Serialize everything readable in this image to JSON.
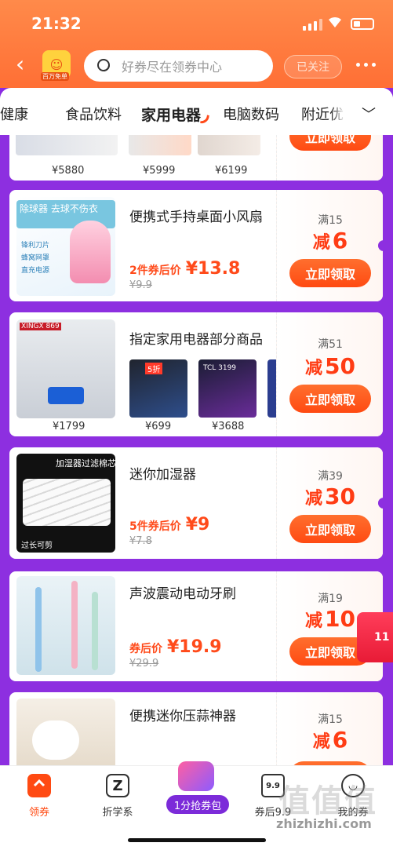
{
  "status": {
    "time": "21:32"
  },
  "header": {
    "shop_badge": "百万免单",
    "search_placeholder": "好券尽在领券中心",
    "follow_label": "已关注"
  },
  "tabs": [
    {
      "label": "康健康"
    },
    {
      "label": "食品饮料"
    },
    {
      "label": "家用电器",
      "active": true
    },
    {
      "label": "电脑数码"
    },
    {
      "label": "附近优"
    }
  ],
  "cards": [
    {
      "thumb_prices": [
        "¥5880",
        "¥5999",
        "¥6199"
      ],
      "claim_label": "立即领取"
    },
    {
      "title": "便携式手持桌面小风扇",
      "image_text": "除球器 去球不伤衣",
      "image_tags": [
        "锋利刀片",
        "蜂窝网罩",
        "直充电源"
      ],
      "price_tag": "2件券后价",
      "price": "¥13.8",
      "orig_price": "¥9.9",
      "threshold": "满15",
      "discount_word": "减",
      "discount_value": "6",
      "claim_label": "立即领取"
    },
    {
      "title": "指定家用电器部分商品",
      "thumb_prices": [
        "¥1799",
        "¥699",
        "¥3688"
      ],
      "thumb_texts": [
        "XINGX 869",
        "5折",
        "TCL 3199"
      ],
      "threshold": "满51",
      "discount_word": "减",
      "discount_value": "50",
      "claim_label": "立即领取"
    },
    {
      "title": "迷你加湿器",
      "image_text": "加湿器过滤棉芯",
      "image_sub": "过长可剪",
      "price_tag": "5件券后价",
      "price": "¥9",
      "orig_price": "¥7.8",
      "threshold": "满39",
      "discount_word": "减",
      "discount_value": "30",
      "claim_label": "立即领取"
    },
    {
      "title": "声波震动电动牙刷",
      "price_tag": "券后价",
      "price": "¥19.9",
      "orig_price": "¥29.9",
      "threshold": "满19",
      "discount_word": "减",
      "discount_value": "10",
      "claim_label": "立即领取"
    },
    {
      "title": "便携迷你压蒜神器",
      "threshold": "满15",
      "discount_word": "减",
      "discount_value": "6"
    }
  ],
  "float_badge": "11",
  "bottom_nav": [
    {
      "label": "领券",
      "icon": "coupon-icon"
    },
    {
      "label": "折学系",
      "icon": "z-icon"
    },
    {
      "label": "1分抢券包",
      "icon": "gift-icon"
    },
    {
      "label": "券后9.9",
      "icon": "nine-nine-icon"
    },
    {
      "label": "我的券",
      "icon": "smile-icon"
    }
  ],
  "watermark": "zhizhizhi.com",
  "colors": {
    "brand": "#ff6f35",
    "accent": "#ff4a12",
    "page_bg": "#8d2fe0"
  }
}
